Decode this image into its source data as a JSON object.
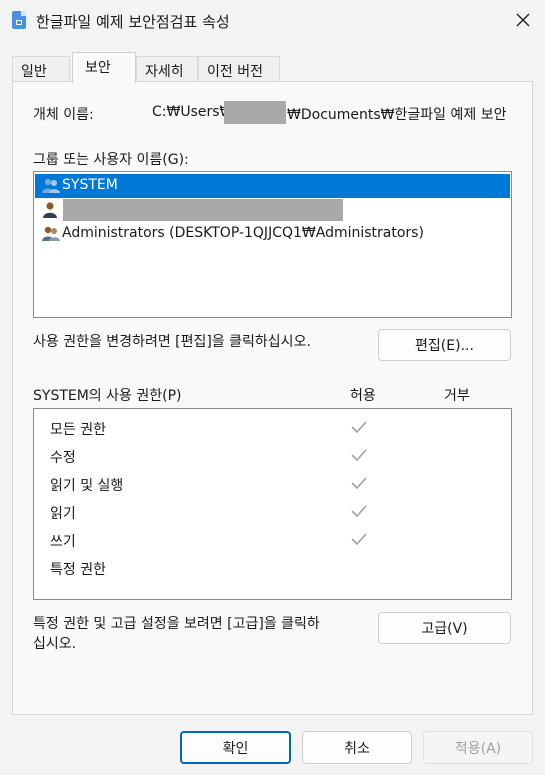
{
  "window": {
    "title": "한글파일 예제 보안점검표 속성"
  },
  "tabs": [
    {
      "label": "일반"
    },
    {
      "label": "보안"
    },
    {
      "label": "자세히"
    },
    {
      "label": "이전 버전"
    }
  ],
  "security": {
    "object_name_label": "개체 이름:",
    "object_path_prefix": "C:₩Users₩",
    "object_path_suffix": "₩Documents₩한글파일 예제 보안",
    "group_label": "그룹 또는 사용자 이름(G):",
    "users": [
      {
        "name": "SYSTEM"
      },
      {
        "name": ""
      },
      {
        "name": "Administrators (DESKTOP-1QJJCQ1₩Administrators)"
      }
    ],
    "change_hint": "사용 권한을 변경하려면 [편집]을 클릭하십시오.",
    "edit_button": "편집(E)...",
    "permissions_header": "SYSTEM의 사용 권한(P)",
    "allow_header": "허용",
    "deny_header": "거부",
    "permissions": [
      {
        "name": "모든 권한",
        "allow": true
      },
      {
        "name": "수정",
        "allow": true
      },
      {
        "name": "읽기 및 실행",
        "allow": true
      },
      {
        "name": "읽기",
        "allow": true
      },
      {
        "name": "쓰기",
        "allow": true
      },
      {
        "name": "특정 권한",
        "allow": false
      }
    ],
    "advanced_hint_line1": "특정 권한 및 고급 설정을 보려면 [고급]을 클릭하",
    "advanced_hint_line2": "십시오.",
    "advanced_button": "고급(V)"
  },
  "footer": {
    "ok": "확인",
    "cancel": "취소",
    "apply": "적용(A)"
  },
  "colors": {
    "selection": "#0078d7",
    "check": "#a0a0a0"
  }
}
